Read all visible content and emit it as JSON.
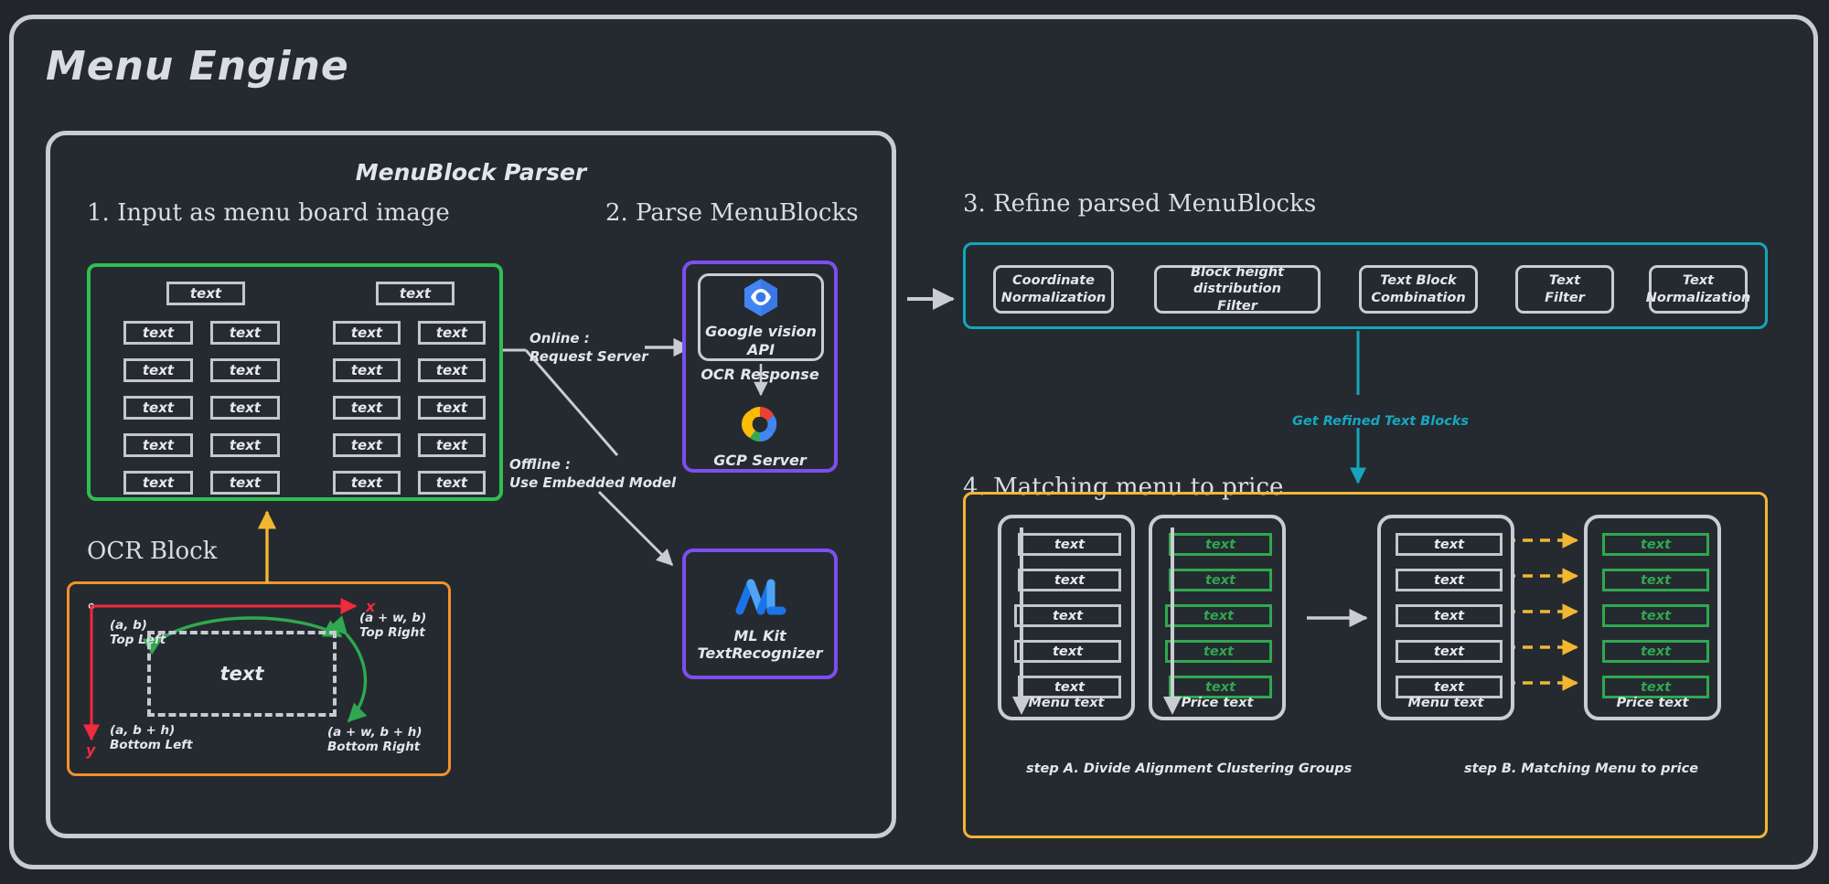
{
  "page": {
    "title": "Menu Engine"
  },
  "parser": {
    "title": "MenuBlock Parser",
    "section1": {
      "heading": "1. Input as menu board image",
      "cell_label": "text"
    },
    "section2": {
      "heading": "2. Parse MenuBlocks"
    },
    "ocr": {
      "heading": "OCR Block",
      "axis_x": "x",
      "axis_y": "y",
      "box_label": "text",
      "top_left": "(a, b)",
      "top_left_name": "Top Left",
      "top_right": "(a + w, b)",
      "top_right_name": "Top Right",
      "bottom_left": "(a, b + h)",
      "bottom_left_name": "Bottom Left",
      "bottom_right": "(a + w, b + h)",
      "bottom_right_name": "Bottom Right"
    },
    "branches": {
      "online_line1": "Online :",
      "online_line2": "Request Server",
      "offline_line1": "Offline :",
      "offline_line2": "Use Embedded Model"
    },
    "online_card": {
      "api_label": "Google vision API",
      "response_label": "OCR Response",
      "server_label": "GCP Server"
    },
    "offline_card": {
      "label_line1": "ML Kit",
      "label_line2": "TextRecognizer"
    }
  },
  "refine": {
    "heading": "3. Refine parsed MenuBlocks",
    "steps": [
      "Coordinate\nNormalization",
      "Block height distribution\nFilter",
      "Text Block\nCombination",
      "Text\nFilter",
      "Text\nNormalization"
    ],
    "connector_label": "Get Refined Text Blocks"
  },
  "matching": {
    "heading": "4. Matching menu to price",
    "cell_label": "text",
    "menu_caption": "Menu text",
    "price_caption": "Price text",
    "step_a_caption": "step A. Divide Alignment Clustering Groups",
    "step_b_caption": "step B. Matching Menu to price"
  },
  "colors": {
    "background": "#22262b",
    "panel": "#252a30",
    "frame": "#c9cdd2",
    "green": "#2fbf4f",
    "orange": "#f0932b",
    "purple": "#7b4ff0",
    "teal": "#15a5bd",
    "yellow": "#f2b632",
    "red": "#ef2b3d"
  }
}
